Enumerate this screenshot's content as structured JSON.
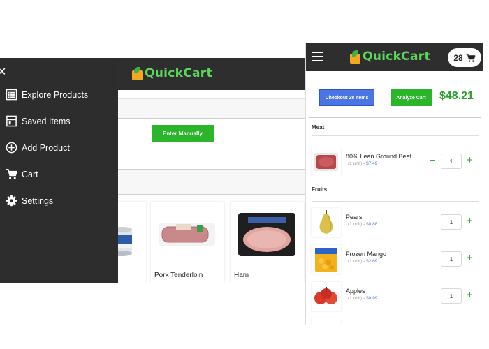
{
  "app": {
    "name": "QuickCart"
  },
  "drawer": {
    "items": [
      {
        "label": "Explore Products",
        "icon": "list-icon"
      },
      {
        "label": "Saved Items",
        "icon": "saved-icon"
      },
      {
        "label": "Add Product",
        "icon": "add-circle-icon"
      },
      {
        "label": "Cart",
        "icon": "cart-icon"
      },
      {
        "label": "Settings",
        "icon": "gear-icon"
      }
    ]
  },
  "left_main": {
    "enter_manually_label": "Enter Manually",
    "products": [
      {
        "name": ""
      },
      {
        "name": "Pork Tenderloin"
      },
      {
        "name": "Ham"
      }
    ]
  },
  "right": {
    "cart_count": "28",
    "checkout_label": "Checkout 28 Items",
    "analyze_label": "Analyze Cart",
    "total": "$48.21",
    "sections": [
      {
        "title": "Meat",
        "items": [
          {
            "name": "80% Lean Ground Beef",
            "unit": "(1 unit)",
            "price": "$7.49",
            "qty": "1"
          }
        ]
      },
      {
        "title": "Fruits",
        "items": [
          {
            "name": "Pears",
            "unit": "(1 unit)",
            "price": "$0.88",
            "qty": "1"
          },
          {
            "name": "Frozen Mango",
            "unit": "(1 unit)",
            "price": "$2.69",
            "qty": "1"
          },
          {
            "name": "Apples",
            "unit": "(1 unit)",
            "price": "$0.99",
            "qty": "1"
          }
        ]
      }
    ],
    "sep": "-",
    "minus": "−",
    "plus": "+"
  },
  "colors": {
    "header": "#2e2e2e",
    "accent_green": "#2bb52b",
    "total_green": "#2aa02a",
    "checkout_blue": "#4a76e3",
    "logo_green": "#5cd65c",
    "logo_orange": "#f5a623"
  }
}
